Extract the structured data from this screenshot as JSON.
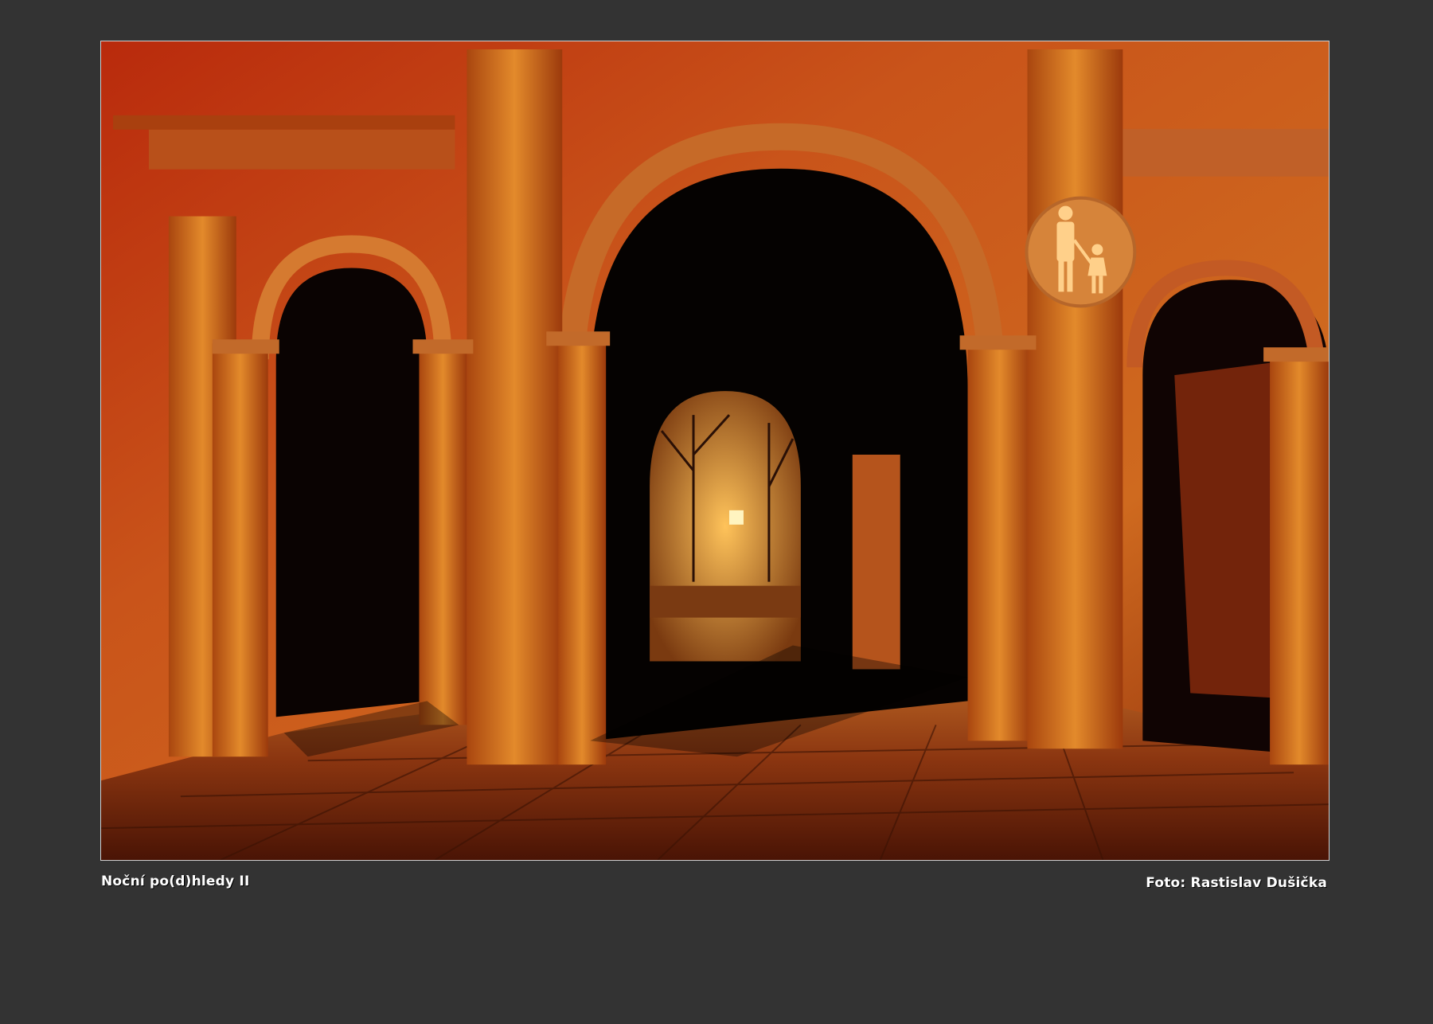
{
  "photo": {
    "title": "Noční po(d)hledy II",
    "credit": "Foto: Rastislav Dušička",
    "frame_color": "#cfcfcf",
    "background_color": "#333333",
    "accent_colors": [
      "#c8440e",
      "#e07a20",
      "#f2a63a",
      "#0b0503"
    ],
    "sign": "pedestrian-sign-icon"
  }
}
